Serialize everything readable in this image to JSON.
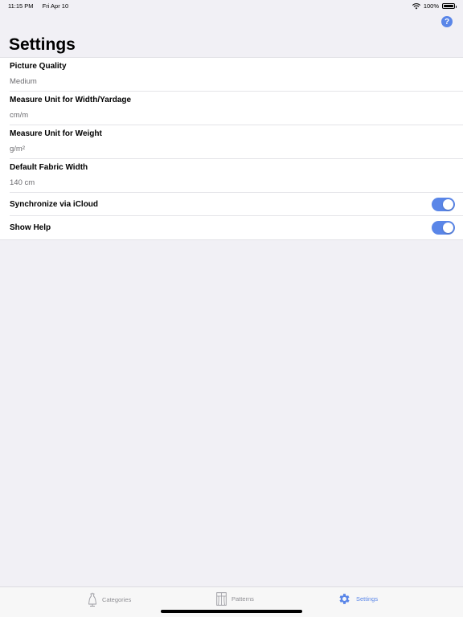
{
  "status_bar": {
    "time": "11:15 PM",
    "date": "Fri Apr 10",
    "battery": "100%"
  },
  "header": {
    "title": "Settings",
    "help_label": "?"
  },
  "settings": {
    "picture_quality": {
      "label": "Picture Quality",
      "value": "Medium"
    },
    "measure_width": {
      "label": "Measure Unit for Width/Yardage",
      "value": "cm/m"
    },
    "measure_weight": {
      "label": "Measure Unit for Weight",
      "value": "g/m²"
    },
    "fabric_width": {
      "label": "Default Fabric Width",
      "value": "140 cm"
    },
    "sync_icloud": {
      "label": "Synchronize via iCloud",
      "on": true
    },
    "show_help": {
      "label": "Show Help",
      "on": true
    }
  },
  "tabs": [
    {
      "label": "Categories",
      "icon": "dress-form-icon",
      "active": false
    },
    {
      "label": "Patterns",
      "icon": "pattern-icon",
      "active": false
    },
    {
      "label": "Settings",
      "icon": "gear-icon",
      "active": true
    }
  ],
  "colors": {
    "accent": "#5a86e8",
    "background": "#f1f0f5"
  }
}
